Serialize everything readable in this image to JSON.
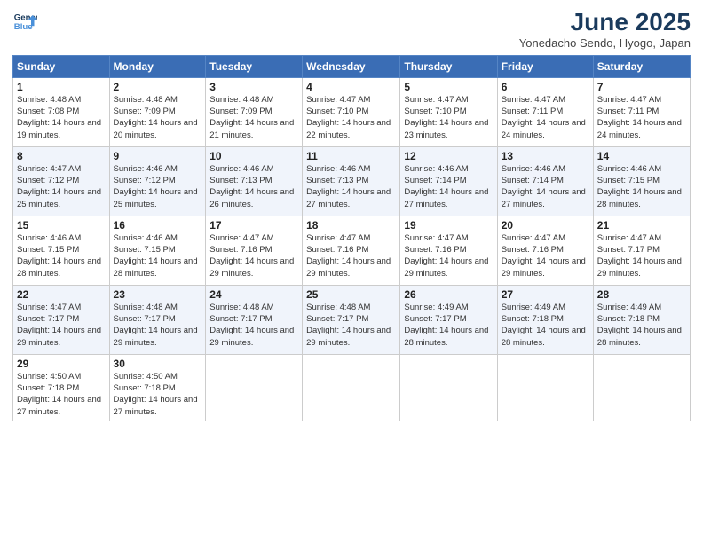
{
  "logo": {
    "line1": "General",
    "line2": "Blue"
  },
  "title": "June 2025",
  "location": "Yonedacho Sendo, Hyogo, Japan",
  "weekdays": [
    "Sunday",
    "Monday",
    "Tuesday",
    "Wednesday",
    "Thursday",
    "Friday",
    "Saturday"
  ],
  "weeks": [
    [
      {
        "day": "1",
        "rise": "4:48 AM",
        "set": "7:08 PM",
        "daylight": "14 hours and 19 minutes."
      },
      {
        "day": "2",
        "rise": "4:48 AM",
        "set": "7:09 PM",
        "daylight": "14 hours and 20 minutes."
      },
      {
        "day": "3",
        "rise": "4:48 AM",
        "set": "7:09 PM",
        "daylight": "14 hours and 21 minutes."
      },
      {
        "day": "4",
        "rise": "4:47 AM",
        "set": "7:10 PM",
        "daylight": "14 hours and 22 minutes."
      },
      {
        "day": "5",
        "rise": "4:47 AM",
        "set": "7:10 PM",
        "daylight": "14 hours and 23 minutes."
      },
      {
        "day": "6",
        "rise": "4:47 AM",
        "set": "7:11 PM",
        "daylight": "14 hours and 24 minutes."
      },
      {
        "day": "7",
        "rise": "4:47 AM",
        "set": "7:11 PM",
        "daylight": "14 hours and 24 minutes."
      }
    ],
    [
      {
        "day": "8",
        "rise": "4:47 AM",
        "set": "7:12 PM",
        "daylight": "14 hours and 25 minutes."
      },
      {
        "day": "9",
        "rise": "4:46 AM",
        "set": "7:12 PM",
        "daylight": "14 hours and 25 minutes."
      },
      {
        "day": "10",
        "rise": "4:46 AM",
        "set": "7:13 PM",
        "daylight": "14 hours and 26 minutes."
      },
      {
        "day": "11",
        "rise": "4:46 AM",
        "set": "7:13 PM",
        "daylight": "14 hours and 27 minutes."
      },
      {
        "day": "12",
        "rise": "4:46 AM",
        "set": "7:14 PM",
        "daylight": "14 hours and 27 minutes."
      },
      {
        "day": "13",
        "rise": "4:46 AM",
        "set": "7:14 PM",
        "daylight": "14 hours and 27 minutes."
      },
      {
        "day": "14",
        "rise": "4:46 AM",
        "set": "7:15 PM",
        "daylight": "14 hours and 28 minutes."
      }
    ],
    [
      {
        "day": "15",
        "rise": "4:46 AM",
        "set": "7:15 PM",
        "daylight": "14 hours and 28 minutes."
      },
      {
        "day": "16",
        "rise": "4:46 AM",
        "set": "7:15 PM",
        "daylight": "14 hours and 28 minutes."
      },
      {
        "day": "17",
        "rise": "4:47 AM",
        "set": "7:16 PM",
        "daylight": "14 hours and 29 minutes."
      },
      {
        "day": "18",
        "rise": "4:47 AM",
        "set": "7:16 PM",
        "daylight": "14 hours and 29 minutes."
      },
      {
        "day": "19",
        "rise": "4:47 AM",
        "set": "7:16 PM",
        "daylight": "14 hours and 29 minutes."
      },
      {
        "day": "20",
        "rise": "4:47 AM",
        "set": "7:16 PM",
        "daylight": "14 hours and 29 minutes."
      },
      {
        "day": "21",
        "rise": "4:47 AM",
        "set": "7:17 PM",
        "daylight": "14 hours and 29 minutes."
      }
    ],
    [
      {
        "day": "22",
        "rise": "4:47 AM",
        "set": "7:17 PM",
        "daylight": "14 hours and 29 minutes."
      },
      {
        "day": "23",
        "rise": "4:48 AM",
        "set": "7:17 PM",
        "daylight": "14 hours and 29 minutes."
      },
      {
        "day": "24",
        "rise": "4:48 AM",
        "set": "7:17 PM",
        "daylight": "14 hours and 29 minutes."
      },
      {
        "day": "25",
        "rise": "4:48 AM",
        "set": "7:17 PM",
        "daylight": "14 hours and 29 minutes."
      },
      {
        "day": "26",
        "rise": "4:49 AM",
        "set": "7:17 PM",
        "daylight": "14 hours and 28 minutes."
      },
      {
        "day": "27",
        "rise": "4:49 AM",
        "set": "7:18 PM",
        "daylight": "14 hours and 28 minutes."
      },
      {
        "day": "28",
        "rise": "4:49 AM",
        "set": "7:18 PM",
        "daylight": "14 hours and 28 minutes."
      }
    ],
    [
      {
        "day": "29",
        "rise": "4:50 AM",
        "set": "7:18 PM",
        "daylight": "14 hours and 27 minutes."
      },
      {
        "day": "30",
        "rise": "4:50 AM",
        "set": "7:18 PM",
        "daylight": "14 hours and 27 minutes."
      },
      null,
      null,
      null,
      null,
      null
    ]
  ]
}
